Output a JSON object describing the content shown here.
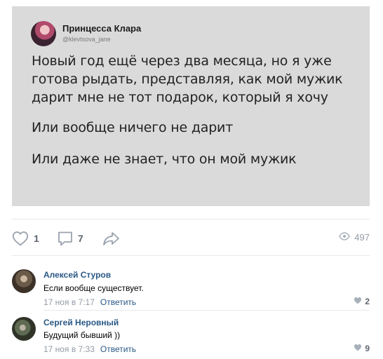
{
  "tweet": {
    "author_name": "Принцесса Клара",
    "author_handle": "@klevtsova_jane",
    "paragraph_1": "Новый год ещё через два месяца, но я уже готова рыдать, представляя, как мой мужик дарит мне не тот подарок, который я хочу",
    "paragraph_2": "Или вообще ничего не дарит",
    "paragraph_3": "Или даже не знает, что он мой мужик"
  },
  "actions": {
    "like_icon": "heart-icon",
    "like_count": "1",
    "comment_icon": "comment-icon",
    "comment_count": "7",
    "share_icon": "share-icon",
    "views_icon": "eye-icon",
    "views_count": "497"
  },
  "comments": [
    {
      "author": "Алексей Стуров",
      "text": "Если вообще существует.",
      "date": "17 ноя в 7:17",
      "reply_label": "Ответить",
      "likes": "2"
    },
    {
      "author": "Сергей Неровный",
      "text": "Будущий бывший ))",
      "date": "17 ноя в 7:33",
      "reply_label": "Ответить",
      "likes": "9"
    }
  ],
  "colors": {
    "link_blue": "#2a5885",
    "muted_grey": "#828a99",
    "card_bg": "#dadada"
  }
}
